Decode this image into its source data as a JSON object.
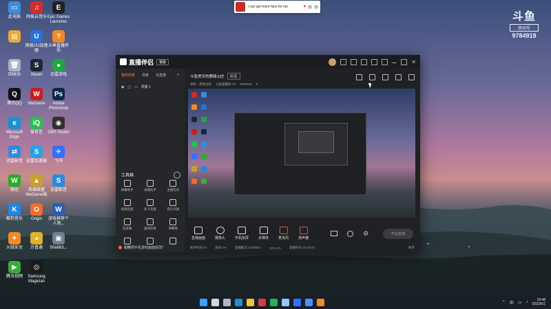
{
  "desktop": {
    "icons": [
      {
        "label": "此电脑",
        "color": "#3c8dde",
        "glyph": "▭",
        "col": 0,
        "row": 0
      },
      {
        "label": "网易云音乐",
        "color": "#d42b2b",
        "glyph": "♫",
        "col": 1,
        "row": 0
      },
      {
        "label": "Epic Games Launcher",
        "color": "#222222",
        "glyph": "E",
        "col": 2,
        "row": 0
      },
      {
        "label": "",
        "color": "#e8a93a",
        "glyph": "▤",
        "col": 0,
        "row": 1
      },
      {
        "label": "网易UU加速器",
        "color": "#2a70d8",
        "glyph": "U",
        "col": 1,
        "row": 1
      },
      {
        "label": "斗鱼直播伴侣",
        "color": "#f08a24",
        "glyph": "?",
        "col": 2,
        "row": 1
      },
      {
        "label": "回收站",
        "color": "#aab4c2",
        "glyph": "🗑",
        "col": 0,
        "row": 2
      },
      {
        "label": "Steam",
        "color": "#1b2838",
        "glyph": "S",
        "col": 1,
        "row": 2
      },
      {
        "label": "迅雷游戏",
        "color": "#21a642",
        "glyph": "●",
        "col": 2,
        "row": 2
      },
      {
        "label": "腾讯QQ",
        "color": "#111111",
        "glyph": "Q",
        "col": 0,
        "row": 3
      },
      {
        "label": "WeGame",
        "color": "#c52020",
        "glyph": "W",
        "col": 1,
        "row": 3
      },
      {
        "label": "Adobe Photoshop",
        "color": "#0a2a4a",
        "glyph": "Ps",
        "col": 2,
        "row": 3
      },
      {
        "label": "Microsoft Edge",
        "color": "#1e8fd0",
        "glyph": "e",
        "col": 0,
        "row": 4
      },
      {
        "label": "爱奇艺",
        "color": "#2ebc4f",
        "glyph": "iQ",
        "col": 1,
        "row": 4
      },
      {
        "label": "OBS Studio",
        "color": "#303030",
        "glyph": "◉",
        "col": 2,
        "row": 4
      },
      {
        "label": "迅雷影音",
        "color": "#2f8be0",
        "glyph": "⇄",
        "col": 0,
        "row": 5
      },
      {
        "label": "迅雷加速器",
        "color": "#2aa0e8",
        "glyph": "S",
        "col": 1,
        "row": 5
      },
      {
        "label": "飞书",
        "color": "#3370ff",
        "glyph": "✈",
        "col": 2,
        "row": 5
      },
      {
        "label": "微信",
        "color": "#2aae2a",
        "glyph": "W",
        "col": 0,
        "row": 6
      },
      {
        "label": "英雄联盟 WeGame版",
        "color": "#c9a030",
        "glyph": "▲",
        "col": 1,
        "row": 6
      },
      {
        "label": "迅雷影音",
        "color": "#2a8be0",
        "glyph": "S",
        "col": 2,
        "row": 6
      },
      {
        "label": "酷狗音乐",
        "color": "#1e88e5",
        "glyph": "K",
        "col": 0,
        "row": 7
      },
      {
        "label": "Origin",
        "color": "#f26b2a",
        "glyph": "O",
        "col": 1,
        "row": 7
      },
      {
        "label": "游戏推荐个人简...",
        "color": "#2a5fb0",
        "glyph": "W",
        "col": 2,
        "row": 7
      },
      {
        "label": "火绒安全",
        "color": "#f08a24",
        "glyph": "✦",
        "col": 0,
        "row": 8
      },
      {
        "label": "万普通",
        "color": "#e0b12a",
        "glyph": "◕",
        "col": 1,
        "row": 8
      },
      {
        "label": "50a6b3...",
        "color": "#6f7f90",
        "glyph": "▣",
        "col": 2,
        "row": 8
      },
      {
        "label": "腾讯视频",
        "color": "#3caa3c",
        "glyph": "▶",
        "col": 0,
        "row": 9
      },
      {
        "label": "Samsung Magician",
        "color": "#1a1a1a",
        "glyph": "◎",
        "col": 1,
        "row": 9
      }
    ]
  },
  "notification": {
    "text": "i can get more fans for me"
  },
  "logo": {
    "mark": "斗鱼",
    "sub": "房间号",
    "room_number": "9784919"
  },
  "app": {
    "name": "直播伴侣",
    "version": "官版",
    "sidebar": {
      "tabs": [
        "我的场景",
        "场景",
        "切直播"
      ],
      "scene": "场景 1",
      "tools_title": "工具箱",
      "tools": [
        "弹幕助手",
        "录播助手",
        "主播任务",
        "视频连麦",
        "多人连麦",
        "音乐点歌",
        "连屏幕",
        "虚拟形象",
        "弹幕库",
        "礼物",
        "",
        ""
      ],
      "hint": "如何把手机游戏画面投屏？"
    },
    "main": {
      "room_title": "斗鱼虎牙的鹿鼎山庄",
      "room_tag": "频道",
      "room_meta": [
        "单机 · 其他主机",
        "斗鱼直播间 V3",
        "9784919",
        "0"
      ],
      "bottom_buttons": [
        "直播画面",
        "摄像头",
        "手机投屏",
        "多媒体",
        "麦克风",
        "扬声器"
      ],
      "go_live": "开始直播",
      "status": [
        "缓冲时间 0s",
        "丢帧 0%",
        "直播推流 0.00Mb/s",
        "CPU 2%",
        "直播时长 00:00:00",
        "断开"
      ]
    }
  },
  "taskbar": {
    "icons": [
      {
        "name": "windows",
        "color": "#3aa0ff"
      },
      {
        "name": "search",
        "color": "#d0d8e0"
      },
      {
        "name": "taskview",
        "color": "#b0b8c8"
      },
      {
        "name": "edge",
        "color": "#1e8fd0"
      },
      {
        "name": "explorer",
        "color": "#f0c040"
      },
      {
        "name": "app-red",
        "color": "#d83a3a"
      },
      {
        "name": "app-green",
        "color": "#2aae5a"
      },
      {
        "name": "app-N",
        "color": "#90c8ff"
      },
      {
        "name": "app-blue",
        "color": "#3370ff"
      },
      {
        "name": "app-feishu",
        "color": "#4a90ff"
      },
      {
        "name": "app-orange",
        "color": "#f08a24"
      }
    ],
    "ime": "中",
    "time": "19:48",
    "date": "2022/6/1"
  }
}
